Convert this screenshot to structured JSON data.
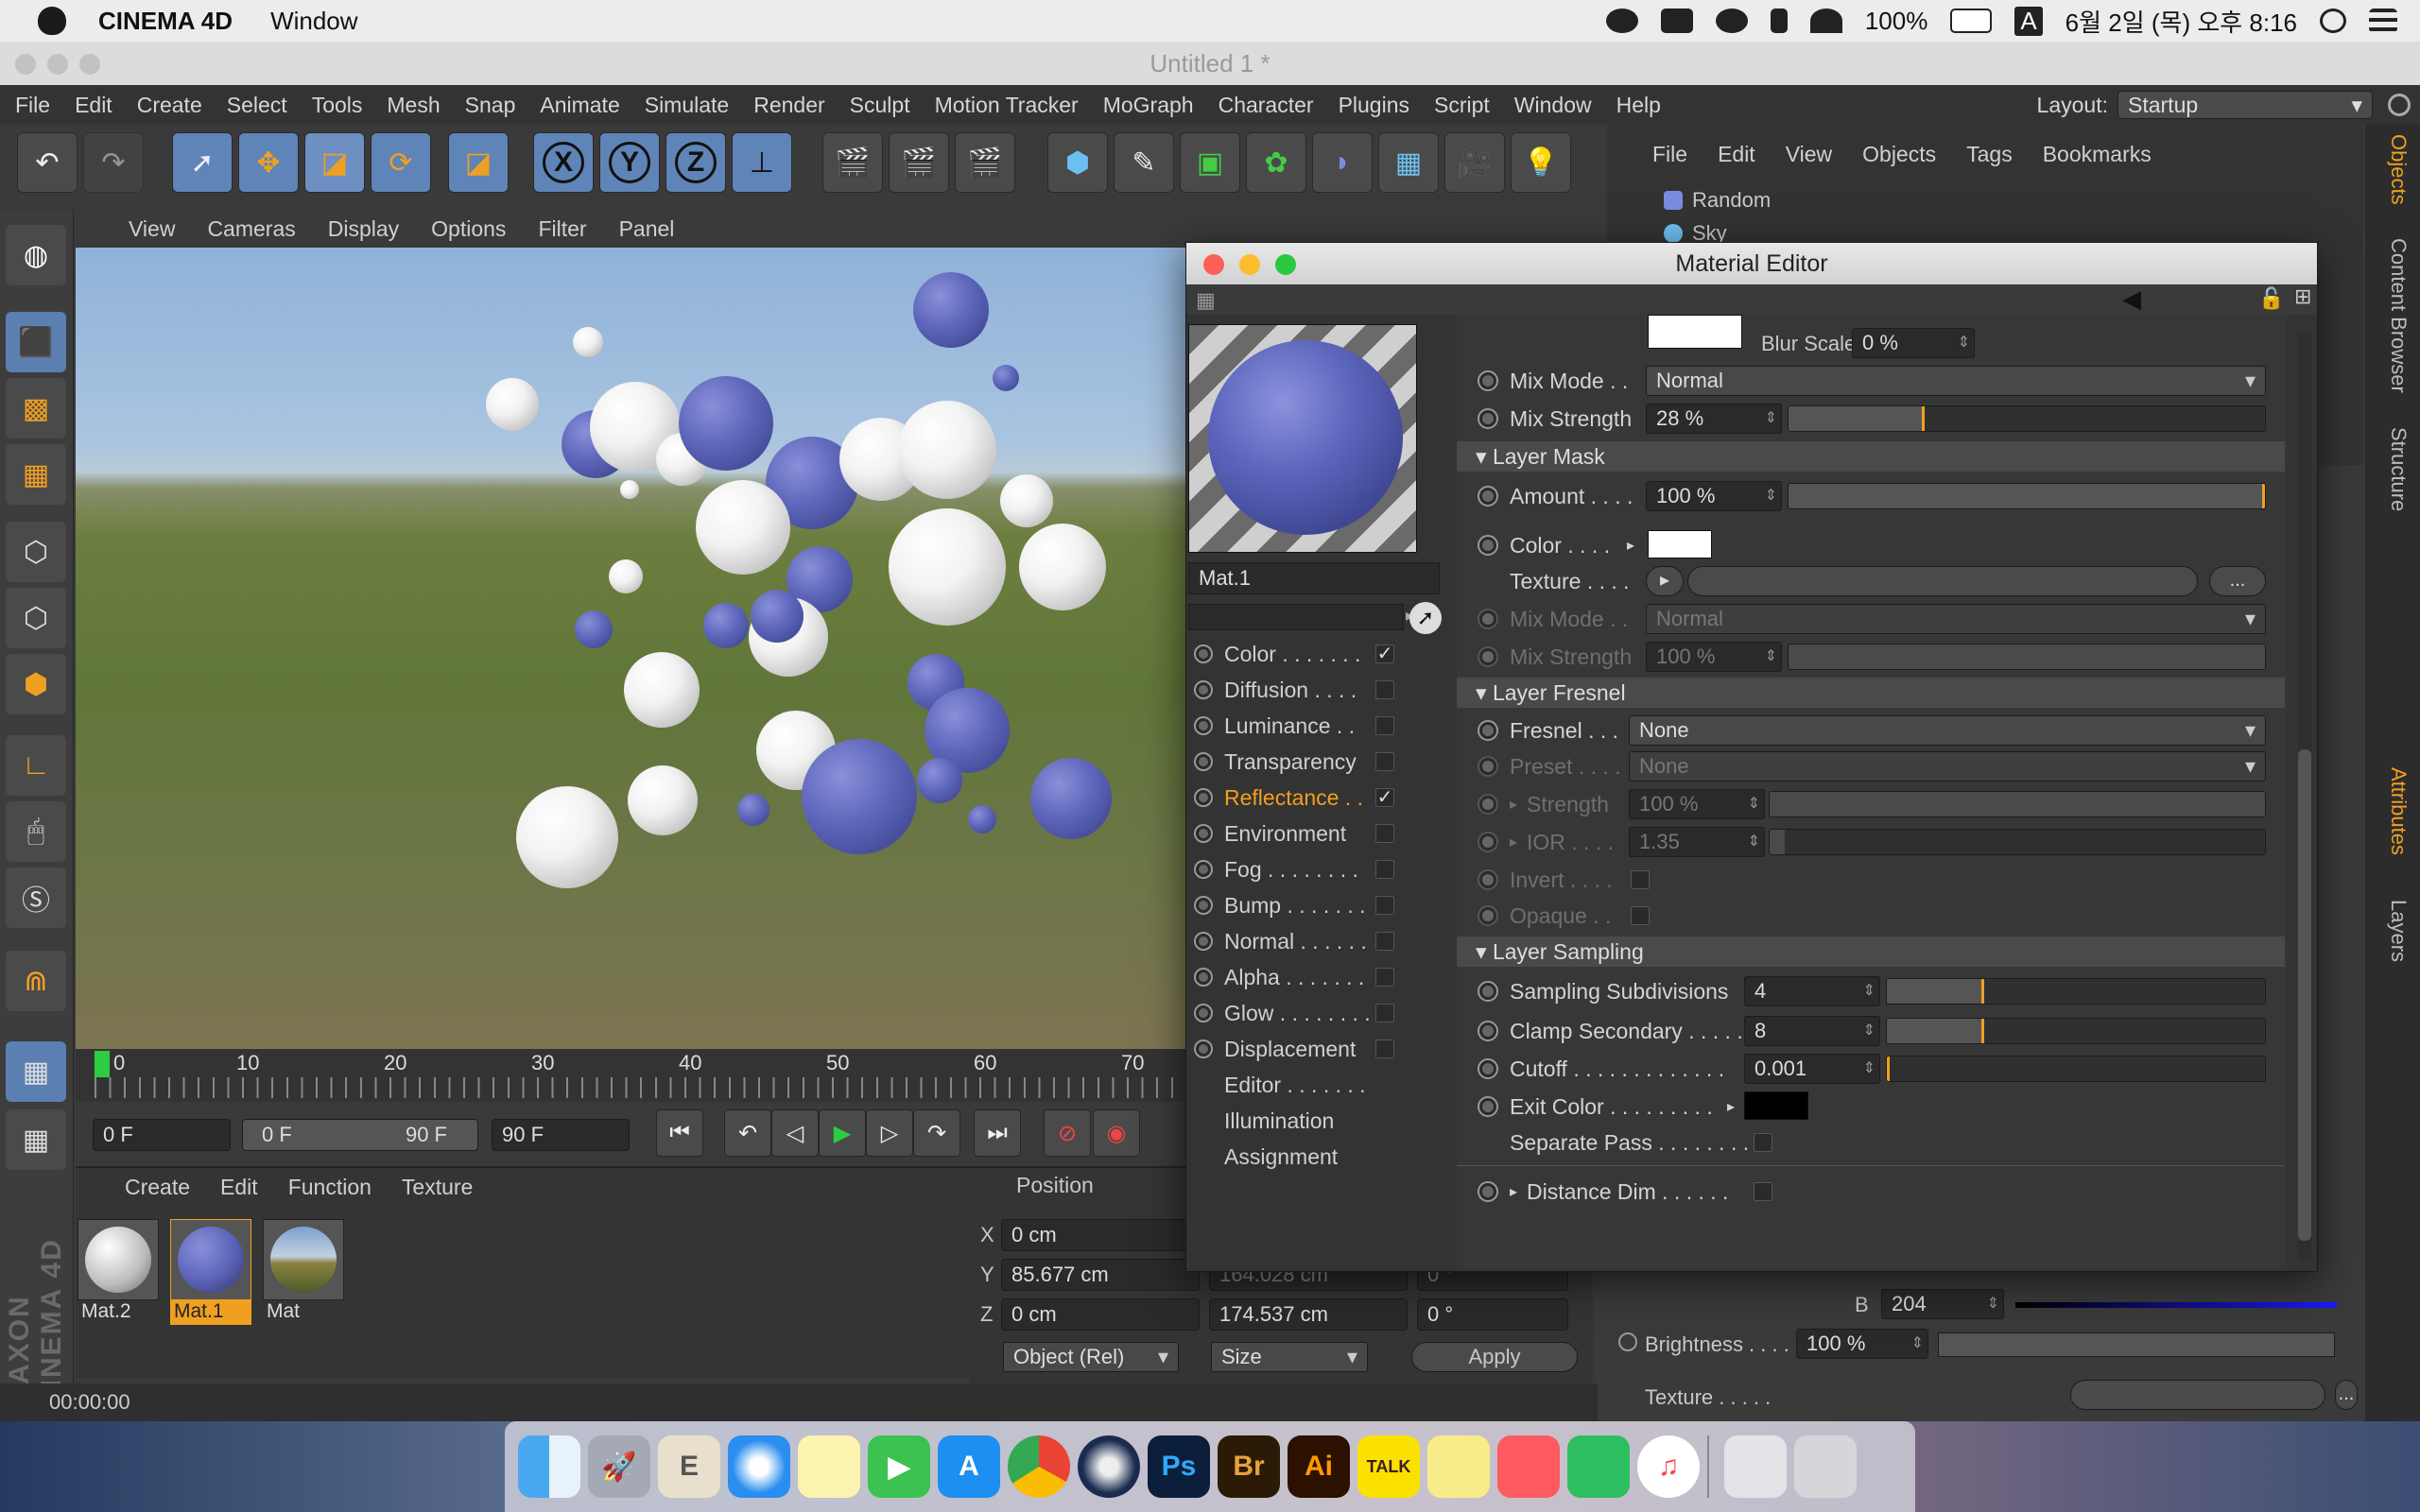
{
  "macbar": {
    "app_name": "CINEMA 4D",
    "menu": "Window",
    "battery": "100%",
    "input_badge": "A",
    "datetime": "6월 2일 (목) 오후 8:16"
  },
  "window": {
    "title": "Untitled 1 *"
  },
  "main_menu": [
    "File",
    "Edit",
    "Create",
    "Select",
    "Tools",
    "Mesh",
    "Snap",
    "Animate",
    "Simulate",
    "Render",
    "Sculpt",
    "Motion Tracker",
    "MoGraph",
    "Character",
    "Plugins",
    "Script",
    "Window",
    "Help"
  ],
  "layout": {
    "label": "Layout:",
    "value": "Startup"
  },
  "toolbar": {
    "x": "X",
    "y": "Y",
    "z": "Z"
  },
  "viewport_menu": [
    "View",
    "Cameras",
    "Display",
    "Options",
    "Filter",
    "Panel"
  ],
  "timeline": {
    "ticks": [
      "0",
      "10",
      "20",
      "30",
      "40",
      "50",
      "60",
      "70"
    ]
  },
  "playback": {
    "current_frame": "0 F",
    "range_start": "0 F",
    "range_end": "90 F",
    "end_frame": "90 F"
  },
  "material_manager": {
    "menu": [
      "Create",
      "Edit",
      "Function",
      "Texture"
    ],
    "materials": [
      {
        "name": "Mat.2"
      },
      {
        "name": "Mat.1"
      },
      {
        "name": "Mat"
      }
    ]
  },
  "coordinates": {
    "header": "Position",
    "x_label": "X",
    "x_pos": "0 cm",
    "y_label": "Y",
    "y_pos": "85.677 cm",
    "z_label": "Z",
    "z_pos": "0 cm",
    "y_size": "164.028 cm",
    "p_val": "0 °",
    "z_size": "174.537 cm",
    "b_val": "0 °",
    "mode": "Object (Rel)",
    "size_mode": "Size",
    "apply": "Apply"
  },
  "status": {
    "time": "00:00:00"
  },
  "object_manager": {
    "menu": [
      "File",
      "Edit",
      "View",
      "Objects",
      "Tags",
      "Bookmarks"
    ],
    "objects": [
      "Random",
      "Sky"
    ]
  },
  "right_tabs": [
    "Objects",
    "Content Browser",
    "Structure",
    "Attributes",
    "Layers"
  ],
  "attributes_bg": {
    "b_label": "B",
    "b_value": "204",
    "brightness_label": "Brightness . . . .",
    "brightness_value": "100 %",
    "texture_label": "Texture . . . . .",
    "ellipsis": "..."
  },
  "material_editor": {
    "title": "Material Editor",
    "material_name": "Mat.1",
    "channels": [
      {
        "label": "Color . . . . . . .",
        "checked": "✓"
      },
      {
        "label": "Diffusion . . . .",
        "checked": ""
      },
      {
        "label": "Luminance . .",
        "checked": ""
      },
      {
        "label": "Transparency",
        "checked": ""
      },
      {
        "label": "Reflectance . .",
        "checked": "✓"
      },
      {
        "label": "Environment",
        "checked": ""
      },
      {
        "label": "Fog . . . . . . . .",
        "checked": ""
      },
      {
        "label": "Bump . . . . . . .",
        "checked": ""
      },
      {
        "label": "Normal . . . . . .",
        "checked": ""
      },
      {
        "label": "Alpha . . . . . . .",
        "checked": ""
      },
      {
        "label": "Glow . . . . . . . .",
        "checked": ""
      },
      {
        "label": "Displacement",
        "checked": ""
      }
    ],
    "extra": [
      "Editor . . . . . . .",
      "Illumination",
      "Assignment"
    ],
    "props": {
      "blur_scale_label": "Blur Scale",
      "blur_scale_value": "0 %",
      "mix_mode_label": "Mix Mode . .",
      "mix_mode_value": "Normal",
      "mix_strength_label": "Mix Strength",
      "mix_strength_value": "28 %",
      "mix_strength_fraction": 0.28,
      "layer_mask_header": "Layer Mask",
      "amount_label": "Amount . . . .",
      "amount_value": "100 %",
      "color_label": "Color . . . .",
      "texture_label": "Texture . . . .",
      "ellipsis": "...",
      "mix_mode2_label": "Mix Mode . .",
      "mix_mode2_value": "Normal",
      "mix_strength2_label": "Mix Strength",
      "mix_strength2_value": "100 %",
      "layer_fresnel_header": "Layer Fresnel",
      "fresnel_label": "Fresnel . . .",
      "fresnel_value": "None",
      "preset_label": "Preset . . . .",
      "preset_value": "None",
      "strength_label": "Strength",
      "strength_value": "100 %",
      "ior_label": "IOR . . . .",
      "ior_value": "1.35",
      "invert_label": "Invert . . . .",
      "opaque_label": "Opaque . .",
      "layer_sampling_header": "Layer Sampling",
      "sampling_subdiv_label": "Sampling Subdivisions",
      "sampling_subdiv_value": "4",
      "clamp_secondary_label": "Clamp Secondary . . . . .",
      "clamp_secondary_value": "8",
      "cutoff_label": "Cutoff . . . . . . . . . . . . .",
      "cutoff_value": "0.001",
      "exit_color_label": "Exit Color . . . . . . . . .",
      "separate_pass_label": "Separate Pass . . . . . . . .",
      "distance_dim_label": "Distance Dim . . . . . ."
    }
  },
  "colors": {
    "accent": "#f0a020",
    "selected_blue": "#5f84b7",
    "white": "#ffffff",
    "black": "#000000"
  },
  "dock_apps": [
    "Finder",
    "Launchpad",
    "TextEdit",
    "Safari",
    "Notes",
    "FaceTime",
    "App Store",
    "Chrome",
    "Cinema 4D",
    "Photoshop",
    "Bridge",
    "Illustrator",
    "KakaoTalk",
    "Stickies",
    "Photo Booth",
    "Evernote",
    "iTunes",
    "Downloads",
    "Trash"
  ]
}
